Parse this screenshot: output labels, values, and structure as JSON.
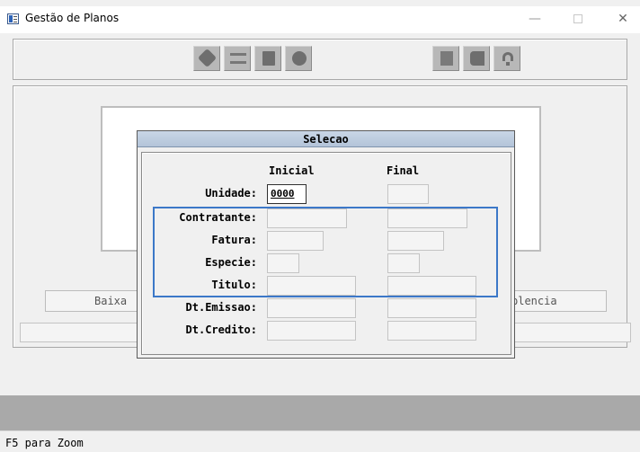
{
  "window": {
    "title": "Gestão de Planos",
    "minimize_glyph": "—",
    "close_glyph": "✕"
  },
  "toolbar": {
    "buttons": [
      "edit-icon",
      "list-icon",
      "copy-icon",
      "settings-icon",
      "report-icon",
      "exit-icon",
      "help-icon"
    ]
  },
  "background": {
    "left_button_label": "Baixa",
    "right_button_label": "plencia"
  },
  "dialog": {
    "title": "Selecao",
    "col_initial": "Inicial",
    "col_final": "Final",
    "fields": [
      {
        "label": "Unidade:",
        "initial": "0000",
        "final": ""
      },
      {
        "label": "Contratante:",
        "initial": "",
        "final": ""
      },
      {
        "label": "Fatura:",
        "initial": "",
        "final": ""
      },
      {
        "label": "Especie:",
        "initial": "",
        "final": ""
      },
      {
        "label": "Titulo:",
        "initial": "",
        "final": ""
      },
      {
        "label": "Dt.Emissao:",
        "initial": "",
        "final": ""
      },
      {
        "label": "Dt.Credito:",
        "initial": "",
        "final": ""
      }
    ]
  },
  "status": {
    "text": "F5 para Zoom"
  },
  "colors": {
    "highlight": "#3c78c8",
    "dialog_title_bg": "#b3c4d9",
    "status_gray": "#a9a9a9"
  }
}
